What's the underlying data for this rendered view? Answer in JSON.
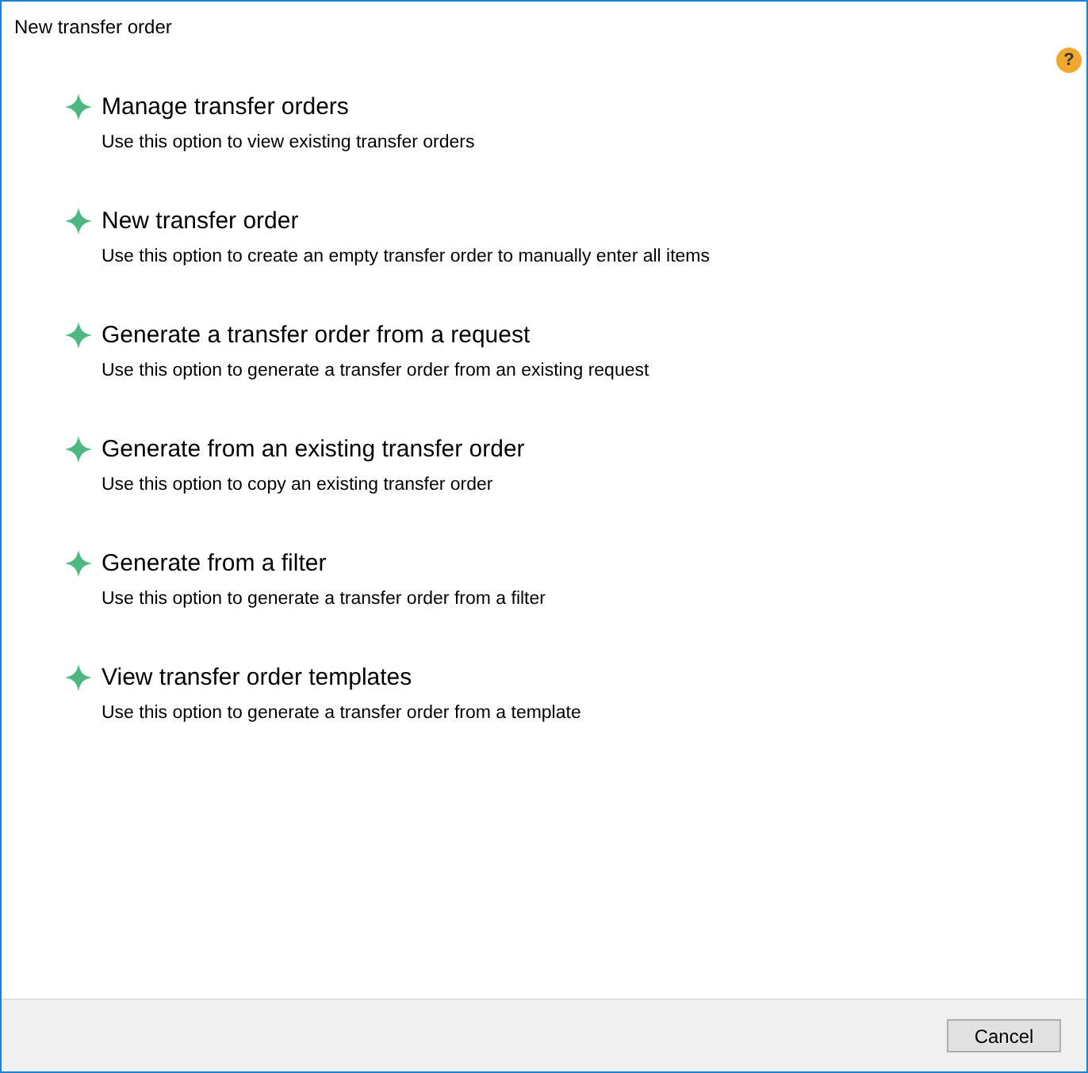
{
  "window": {
    "title": "New transfer order"
  },
  "help_button": {
    "label": "?"
  },
  "options": [
    {
      "title": "Manage transfer orders",
      "description": "Use this option to view existing transfer orders"
    },
    {
      "title": "New transfer order",
      "description": "Use this option to create an empty transfer order to manually enter all items"
    },
    {
      "title": "Generate a transfer order from a request",
      "description": "Use this option to generate a transfer order from an existing request"
    },
    {
      "title": "Generate from an existing transfer order",
      "description": "Use this option to copy an existing transfer order"
    },
    {
      "title": "Generate from a filter",
      "description": "Use this option to generate a transfer order from a filter"
    },
    {
      "title": "View transfer order templates",
      "description": "Use this option to generate a transfer order from a template"
    }
  ],
  "buttons": [
    {
      "label": "Cancel"
    }
  ]
}
